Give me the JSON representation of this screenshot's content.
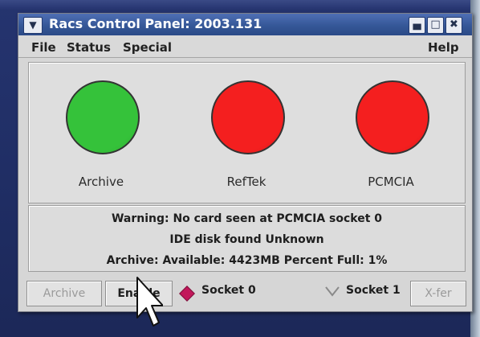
{
  "window": {
    "title": "Racs Control Panel: 2003.131",
    "menu_icon": "chevron-down-icon",
    "controls": {
      "minimize_icon": "minimize-icon",
      "maximize_icon": "maximize-icon",
      "close_icon": "close-icon"
    }
  },
  "menubar": {
    "items": [
      "File",
      "Status",
      "Special"
    ],
    "help": "Help"
  },
  "indicators": [
    {
      "label": "Archive",
      "status": "ok",
      "color": "#35c23a"
    },
    {
      "label": "RefTek",
      "status": "error",
      "color": "#f41f1f"
    },
    {
      "label": "PCMCIA",
      "status": "error",
      "color": "#f41f1f"
    }
  ],
  "status": {
    "lines": [
      "Warning: No card seen at PCMCIA socket 0",
      "IDE disk found Unknown",
      "Archive:  Available: 4423MB Percent Full: 1%"
    ]
  },
  "buttons": {
    "archive": "Archive",
    "enable": "Enable",
    "xfer": "X-fer"
  },
  "sockets": {
    "options": [
      "Socket 0",
      "Socket 1"
    ],
    "selected": "Socket 0"
  }
}
